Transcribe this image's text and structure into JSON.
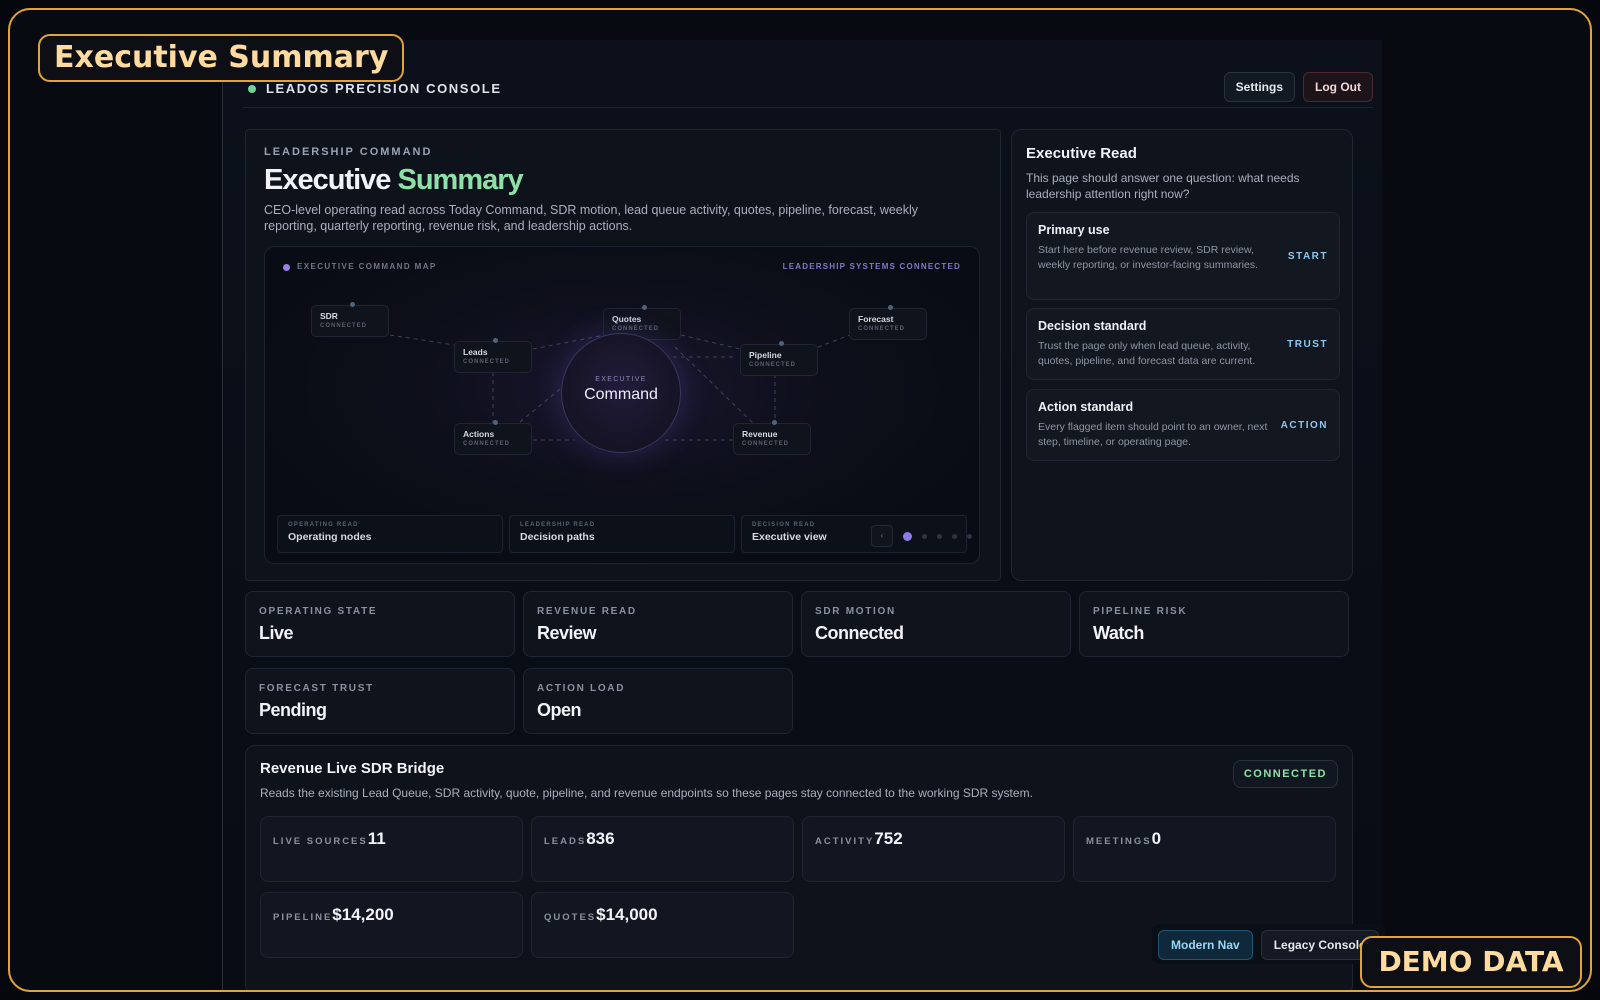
{
  "overlay": {
    "title_badge": "Executive Summary",
    "demo_badge": "DEMO DATA"
  },
  "topbar": {
    "brand": "LEADOS PRECISION CONSOLE",
    "settings": "Settings",
    "logout": "Log Out"
  },
  "hero": {
    "eyebrow": "LEADERSHIP COMMAND",
    "title_main": "Executive",
    "title_accent": "Summary",
    "description": "CEO-level operating read across Today Command, SDR motion, lead queue activity, quotes, pipeline, forecast, weekly reporting, quarterly reporting, revenue risk, and leadership actions."
  },
  "map": {
    "header_left": "EXECUTIVE COMMAND MAP",
    "header_right": "LEADERSHIP SYSTEMS CONNECTED",
    "core_label": "EXECUTIVE",
    "core_name": "Command",
    "nodes": [
      {
        "name": "SDR",
        "status": "CONNECTED"
      },
      {
        "name": "Leads",
        "status": "CONNECTED"
      },
      {
        "name": "Quotes",
        "status": "CONNECTED"
      },
      {
        "name": "Forecast",
        "status": "CONNECTED"
      },
      {
        "name": "Pipeline",
        "status": "CONNECTED"
      },
      {
        "name": "Actions",
        "status": "CONNECTED"
      },
      {
        "name": "Revenue",
        "status": "CONNECTED"
      }
    ],
    "footer": [
      {
        "label": "OPERATING READ",
        "value": "Operating nodes"
      },
      {
        "label": "LEADERSHIP READ",
        "value": "Decision paths"
      },
      {
        "label": "DECISION READ",
        "value": "Executive view"
      }
    ],
    "pager_prev": "‹"
  },
  "read": {
    "title": "Executive Read",
    "description": "This page should answer one question: what needs leadership attention right now?",
    "cards": [
      {
        "title": "Primary use",
        "body": "Start here before revenue review, SDR review, weekly reporting, or investor-facing summaries.",
        "tag": "START"
      },
      {
        "title": "Decision standard",
        "body": "Trust the page only when lead queue, activity, quotes, pipeline, and forecast data are current.",
        "tag": "TRUST"
      },
      {
        "title": "Action standard",
        "body": "Every flagged item should point to an owner, next step, timeline, or operating page.",
        "tag": "ACTION"
      }
    ]
  },
  "stats": [
    {
      "label": "OPERATING STATE",
      "value": "Live"
    },
    {
      "label": "REVENUE READ",
      "value": "Review"
    },
    {
      "label": "SDR MOTION",
      "value": "Connected"
    },
    {
      "label": "PIPELINE RISK",
      "value": "Watch"
    },
    {
      "label": "FORECAST TRUST",
      "value": "Pending"
    },
    {
      "label": "ACTION LOAD",
      "value": "Open"
    }
  ],
  "bridge": {
    "title": "Revenue Live SDR Bridge",
    "description": "Reads the existing Lead Queue, SDR activity, quote, pipeline, and revenue endpoints so these pages stay connected to the working SDR system.",
    "status": "CONNECTED",
    "metrics": [
      {
        "label": "LIVE SOURCES",
        "value": "11"
      },
      {
        "label": "LEADS",
        "value": "836"
      },
      {
        "label": "ACTIVITY",
        "value": "752"
      },
      {
        "label": "MEETINGS",
        "value": "0"
      },
      {
        "label": "PIPELINE",
        "value": "$14,200"
      },
      {
        "label": "QUOTES",
        "value": "$14,000"
      }
    ]
  },
  "navswitch": {
    "modern": "Modern Nav",
    "legacy": "Legacy Console"
  }
}
